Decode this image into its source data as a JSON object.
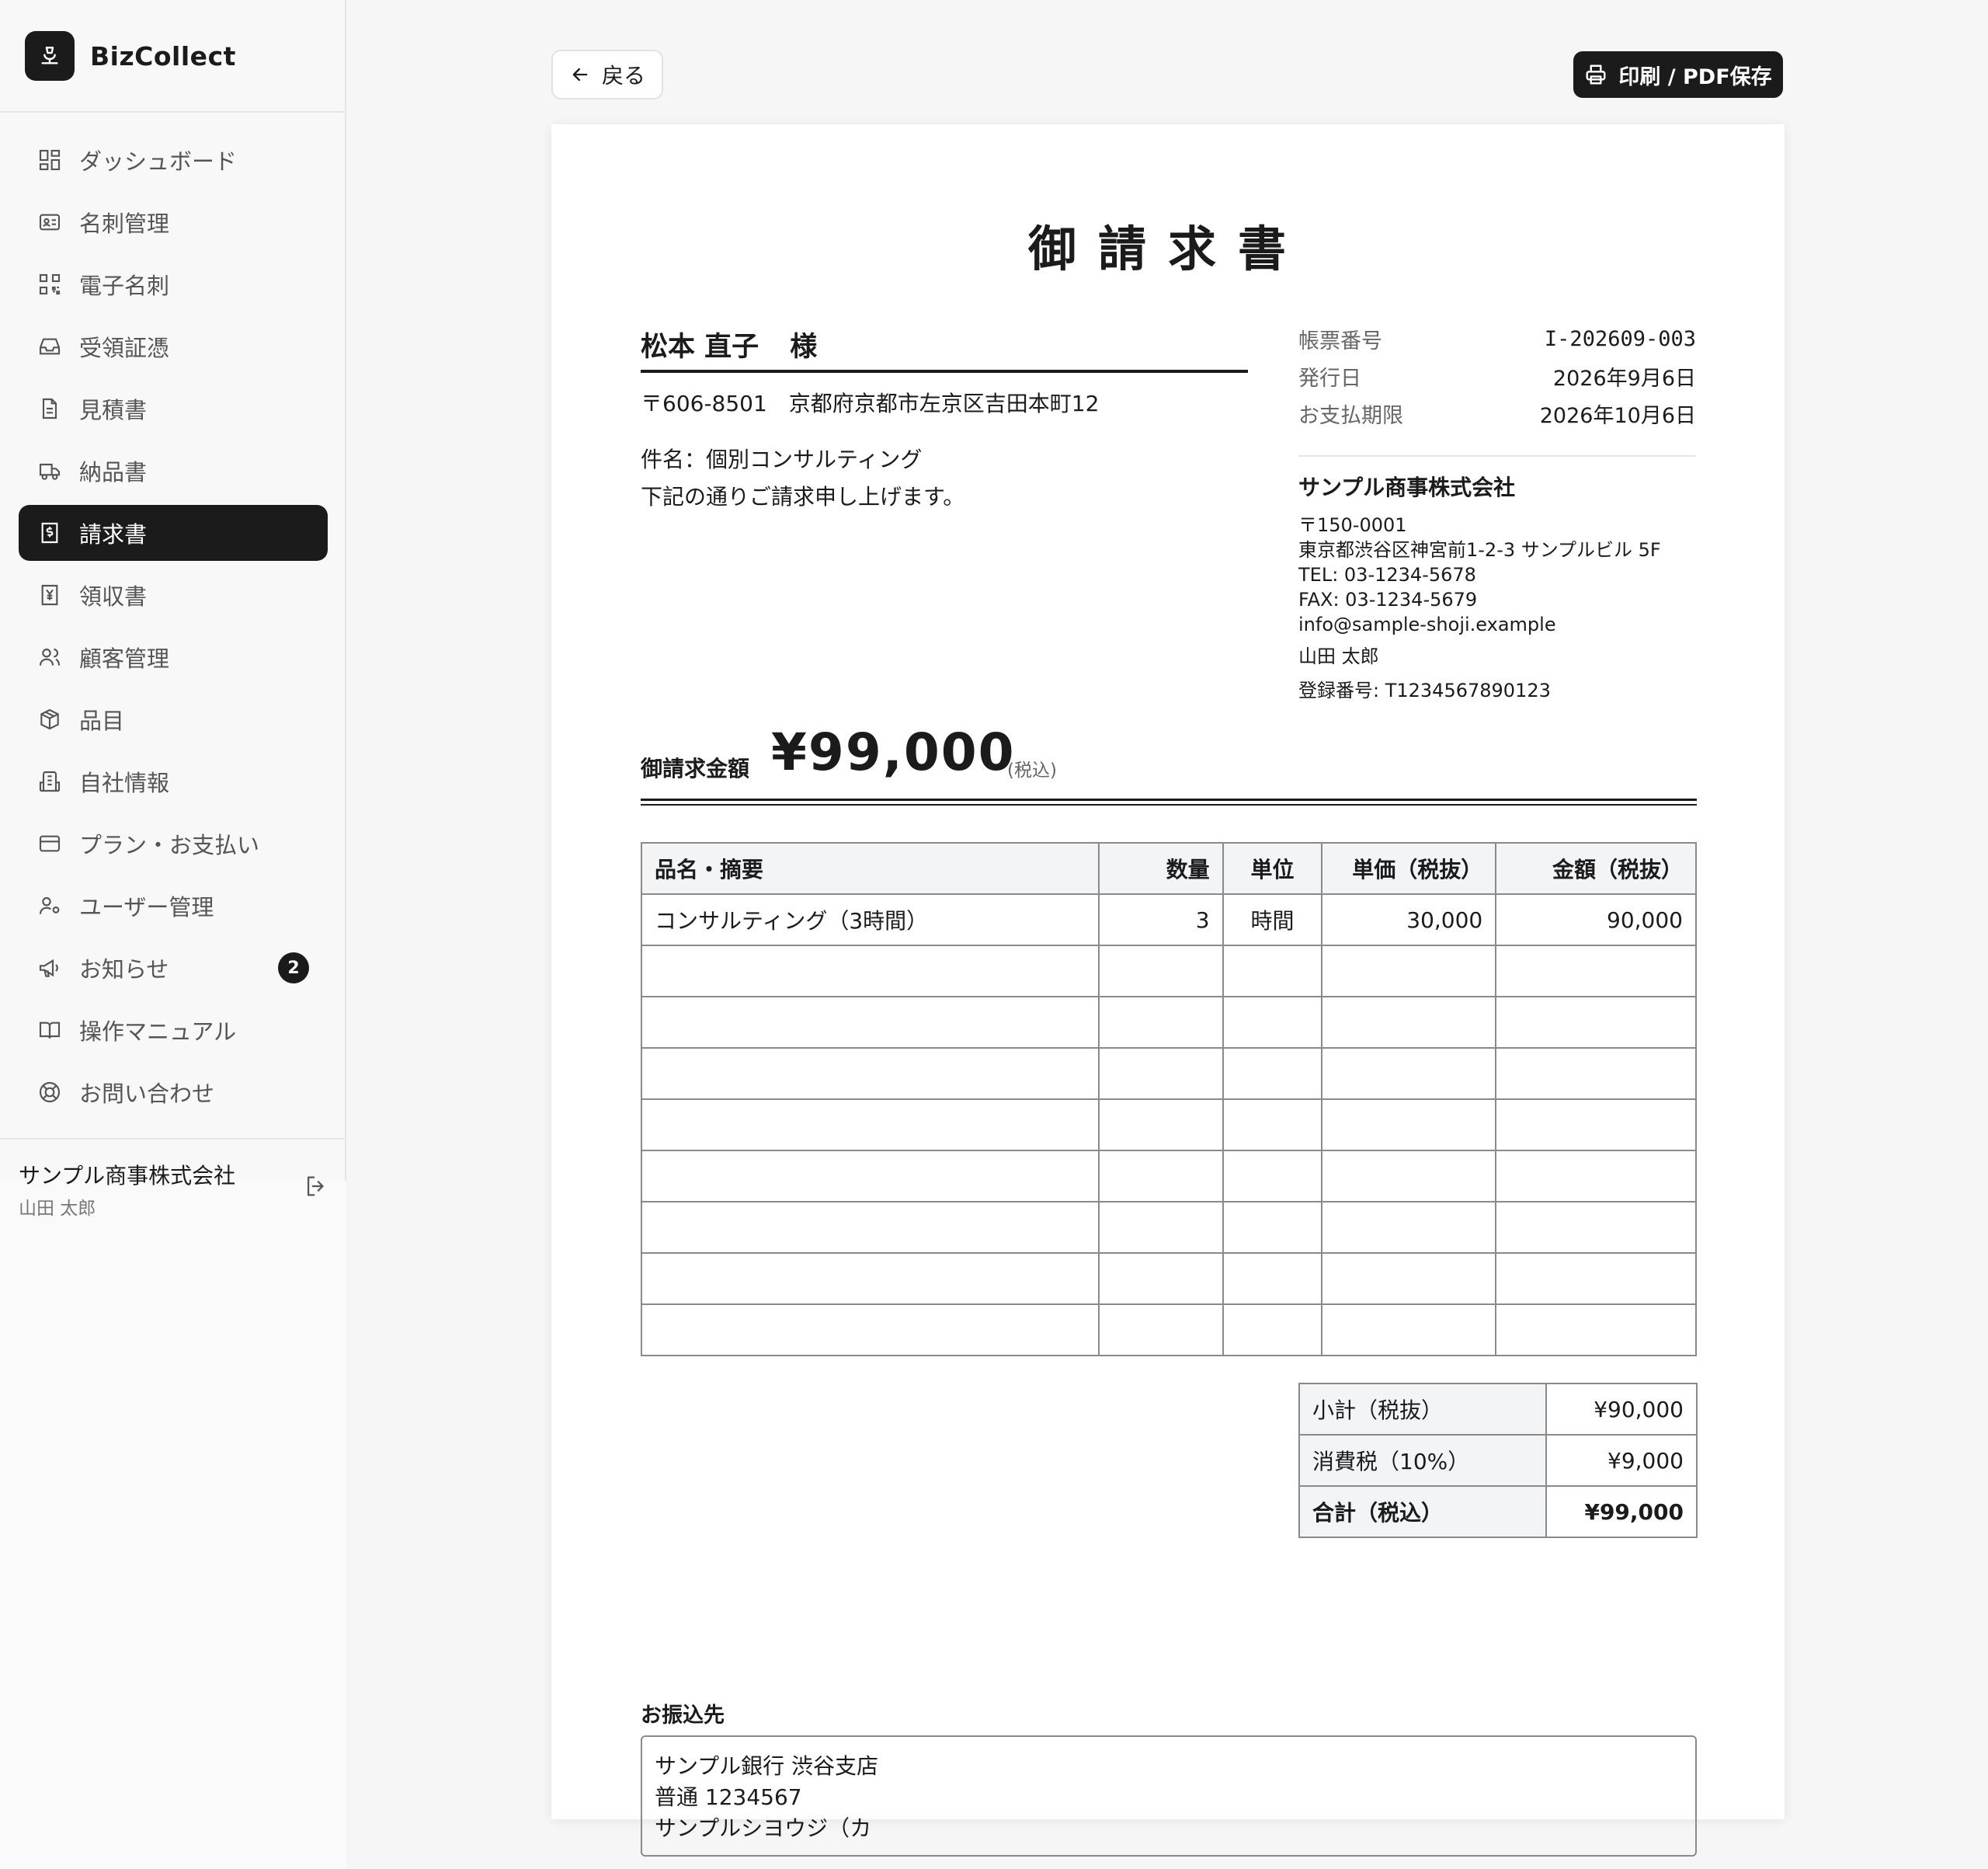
{
  "app": {
    "name": "BizCollect"
  },
  "sidebar": {
    "items": [
      {
        "label": "ダッシュボード",
        "icon": "dashboard-icon"
      },
      {
        "label": "名刺管理",
        "icon": "id-card-icon"
      },
      {
        "label": "電子名刺",
        "icon": "qr-code-icon"
      },
      {
        "label": "受領証憑",
        "icon": "inbox-icon"
      },
      {
        "label": "見積書",
        "icon": "document-icon"
      },
      {
        "label": "納品書",
        "icon": "truck-icon"
      },
      {
        "label": "請求書",
        "icon": "invoice-icon",
        "active": true
      },
      {
        "label": "領収書",
        "icon": "yen-receipt-icon"
      },
      {
        "label": "顧客管理",
        "icon": "users-icon"
      },
      {
        "label": "品目",
        "icon": "package-icon"
      },
      {
        "label": "自社情報",
        "icon": "building-icon"
      },
      {
        "label": "プラン・お支払い",
        "icon": "credit-card-icon"
      },
      {
        "label": "ユーザー管理",
        "icon": "user-cog-icon"
      },
      {
        "label": "お知らせ",
        "icon": "megaphone-icon",
        "badge": "2"
      },
      {
        "label": "操作マニュアル",
        "icon": "book-icon"
      },
      {
        "label": "お問い合わせ",
        "icon": "lifebuoy-icon"
      }
    ],
    "account": {
      "company": "サンプル商事株式会社",
      "user": "山田 太郎"
    }
  },
  "toolbar": {
    "back_label": "戻る",
    "print_label": "印刷 / PDF保存"
  },
  "invoice": {
    "title": "御請求書",
    "recipient": {
      "name": "松本 直子",
      "honorific": "様",
      "address": "〒606-8501　京都府京都市左京区吉田本町12"
    },
    "subject": "件名：個別コンサルティング",
    "message": "下記の通りご請求申し上げます。",
    "meta": [
      {
        "label": "帳票番号",
        "value": "I-202609-003"
      },
      {
        "label": "発行日",
        "value": "2026年9月6日"
      },
      {
        "label": "お支払期限",
        "value": "2026年10月6日"
      }
    ],
    "issuer": {
      "company": "サンプル商事株式会社",
      "postal": "〒150-0001",
      "address": "東京都渋谷区神宮前1-2-3 サンプルビル 5F",
      "tel": "TEL: 03-1234-5678",
      "fax": "FAX: 03-1234-5679",
      "email": "info@sample-shoji.example",
      "person": "山田 太郎",
      "registration": "登録番号: T1234567890123"
    },
    "amount": {
      "label": "御請求金額",
      "value": "¥99,000",
      "tax_note": "(税込)"
    },
    "table": {
      "headers": [
        "品名・摘要",
        "数量",
        "単位",
        "単価（税抜）",
        "金額（税抜）"
      ],
      "rows": [
        [
          "コンサルティング（3時間）",
          "3",
          "時間",
          "30,000",
          "90,000"
        ]
      ],
      "empty_rows": 8
    },
    "totals": [
      {
        "label": "小計（税抜）",
        "value": "¥90,000"
      },
      {
        "label": "消費税（10%）",
        "value": "¥9,000"
      },
      {
        "label": "合計（税込）",
        "value": "¥99,000"
      }
    ],
    "bank": {
      "label": "お振込先",
      "lines": [
        "サンプル銀行 渋谷支店",
        "普通 1234567",
        "サンプルシヨウジ（カ"
      ]
    }
  },
  "colors": {
    "primary": "#1b1b1b",
    "background": "#f6f6f7",
    "table_header_bg": "#f3f4f6"
  }
}
